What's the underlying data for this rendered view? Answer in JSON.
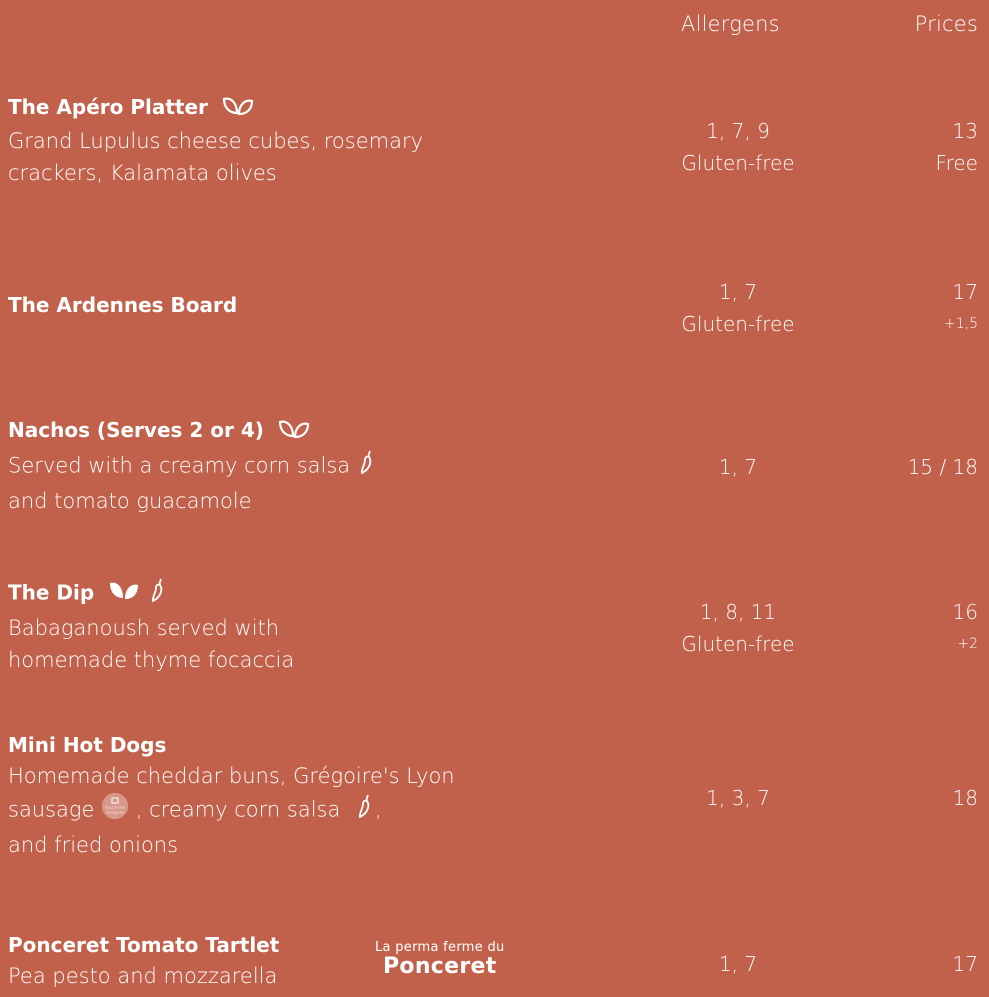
{
  "header": {
    "allergens": "Allergens",
    "prices": "Prices"
  },
  "items": [
    {
      "name": "The Apéro Platter",
      "desc": [
        "Grand Lupulus cheese cubes, rosemary",
        "crackers, Kalamata olives"
      ],
      "allergens": "1, 7, 9",
      "allergens_note": "Gluten-free",
      "price": "13",
      "price_note": "Free"
    },
    {
      "name": "The Ardennes Board",
      "allergens": "1, 7",
      "allergens_note": "Gluten-free",
      "price": "17",
      "price_note": "+1,5"
    },
    {
      "name": "Nachos (Serves 2 or 4)",
      "desc": [
        "Served with a creamy corn salsa",
        "and tomato guacamole"
      ],
      "allergens": "1, 7",
      "price": "15 / 18"
    },
    {
      "name": "The Dip",
      "desc": [
        "Babaganoush served with",
        "homemade thyme focaccia"
      ],
      "allergens": "1, 8, 11",
      "allergens_note": "Gluten-free",
      "price": "16",
      "price_note": "+2"
    },
    {
      "name": "Mini Hot Dogs",
      "desc": [
        "Homemade cheddar buns, Grégoire's Lyon",
        "sausage",
        ", creamy corn salsa",
        ",",
        "and fried onions"
      ],
      "allergens": "1, 3, 7",
      "price": "18"
    },
    {
      "name": "Ponceret Tomato Tartlet",
      "desc": [
        "Pea pesto and mozzarella"
      ],
      "allergens": "1, 7",
      "price": "17"
    }
  ],
  "logo": {
    "line1": "La perma ferme du",
    "line2": "Ponceret",
    "badge_line1": "Boucherie",
    "badge_line2": "Grégoire"
  },
  "icons": {
    "vegetarian": "leaf-outline-icon",
    "vegan": "leaf-filled-icon",
    "spicy": "chili-pepper-icon",
    "butcher": "butcher-badge-icon"
  },
  "colors": {
    "background": "#c2614b",
    "text": "#ffffff"
  }
}
